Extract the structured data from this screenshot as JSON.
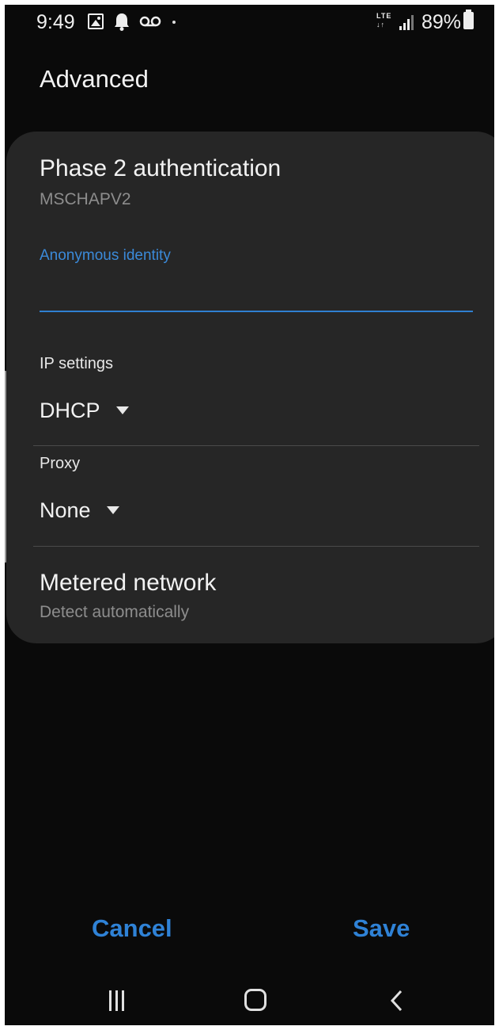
{
  "status_bar": {
    "time": "9:49",
    "network_type": "LTE",
    "battery": "89%",
    "icons": [
      "gallery-icon",
      "bell-icon",
      "voicemail-icon",
      "dot-icon",
      "signal-icon",
      "battery-icon"
    ]
  },
  "page": {
    "title": "Advanced"
  },
  "settings": {
    "phase2": {
      "title": "Phase 2 authentication",
      "value": "MSCHAPV2"
    },
    "anonymous_identity": {
      "label": "Anonymous identity",
      "value": ""
    },
    "ip_settings": {
      "label": "IP settings",
      "value": "DHCP"
    },
    "proxy": {
      "label": "Proxy",
      "value": "None"
    },
    "metered": {
      "title": "Metered network",
      "value": "Detect automatically"
    }
  },
  "actions": {
    "cancel": "Cancel",
    "save": "Save"
  },
  "navbar": {
    "icons": [
      "recents-icon",
      "home-icon",
      "back-icon"
    ]
  },
  "colors": {
    "background": "#0a0a0a",
    "card": "#262626",
    "accent": "#2f82d6",
    "text_primary": "#f2f2f2",
    "text_secondary": "#8d8d8d"
  }
}
